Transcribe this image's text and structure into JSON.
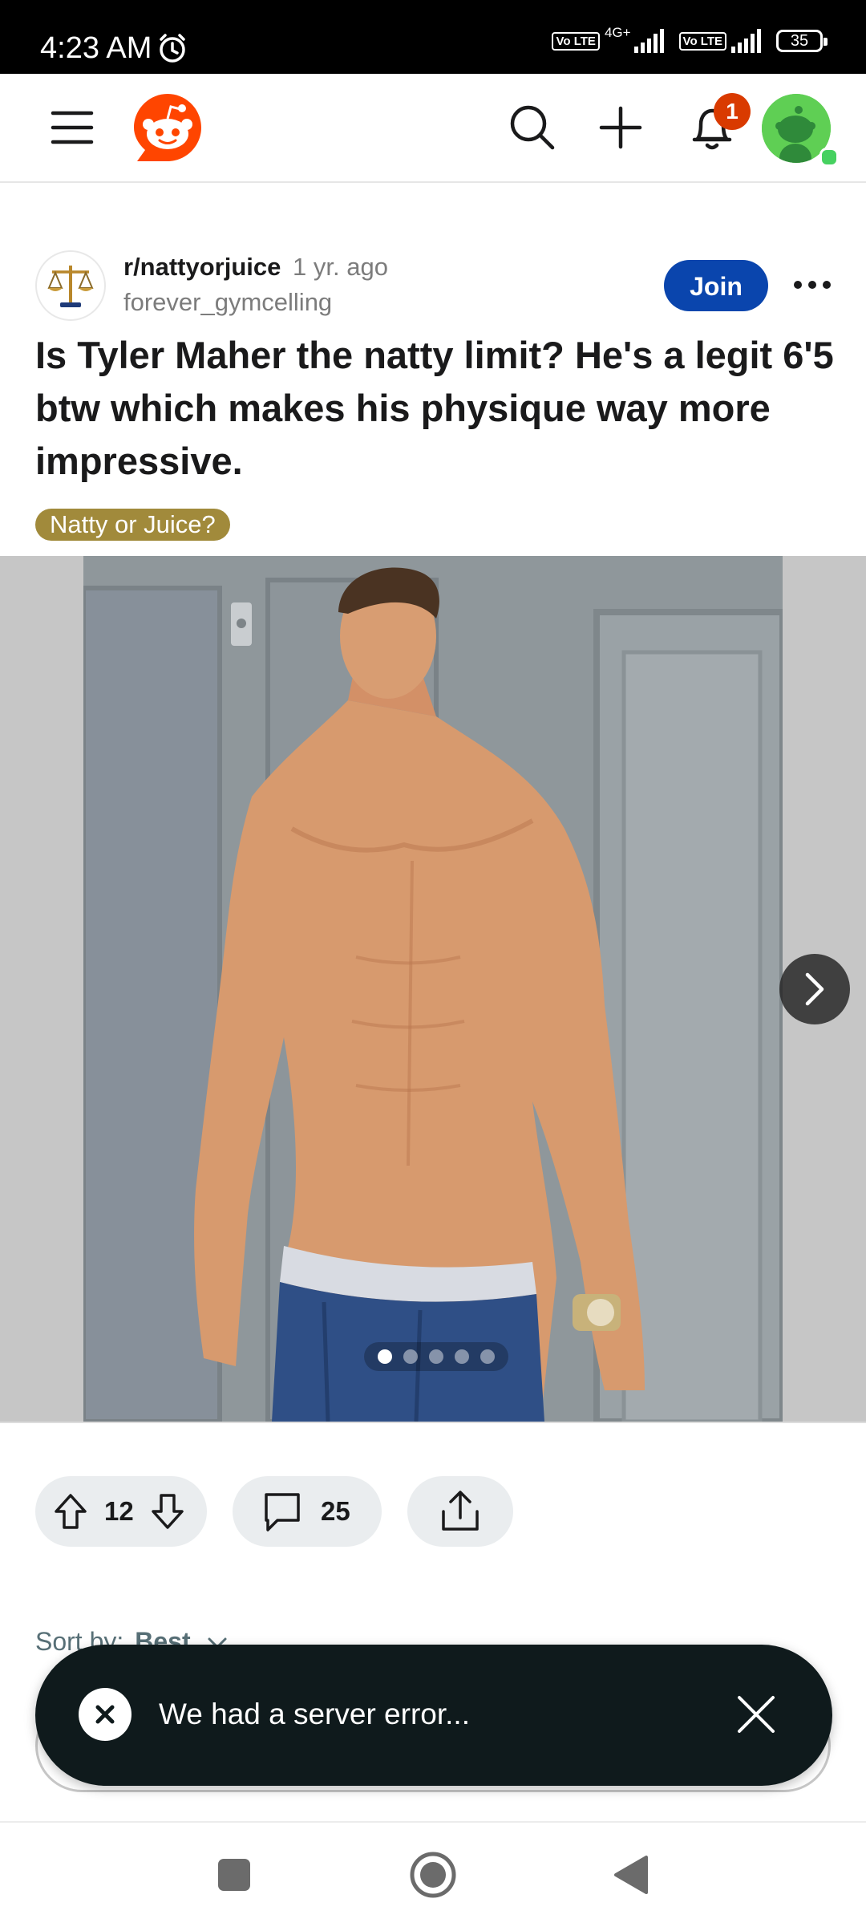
{
  "status_bar": {
    "time": "4:23 AM",
    "network_1": "4G+",
    "volte_1": "Vo LTE",
    "volte_2": "Vo LTE",
    "battery": "35"
  },
  "header": {
    "notification_count": "1",
    "icons": [
      "menu-icon",
      "reddit-logo",
      "search-icon",
      "plus-icon",
      "bell-icon",
      "avatar"
    ]
  },
  "post": {
    "subreddit": "r/nattyorjuice",
    "age": "1 yr. ago",
    "author": "forever_gymcelling",
    "join_label": "Join",
    "title": "Is Tyler Maher the natty limit? He's a legit 6'5 btw which makes his physique way more impressive.",
    "flair": "Natty or Juice?",
    "gallery": {
      "total_images": 5,
      "current_index": 1
    },
    "upvotes": "12",
    "comments": "25"
  },
  "comments_section": {
    "sort_label": "Sort by:",
    "sort_value": "Best"
  },
  "toast": {
    "message": "We had a server error..."
  },
  "colors": {
    "join": "#0a45ad",
    "flair": "#a18a3b",
    "badge": "#d93a00",
    "toast_bg": "#0f1a1c",
    "reddit_orange": "#ff4500"
  }
}
